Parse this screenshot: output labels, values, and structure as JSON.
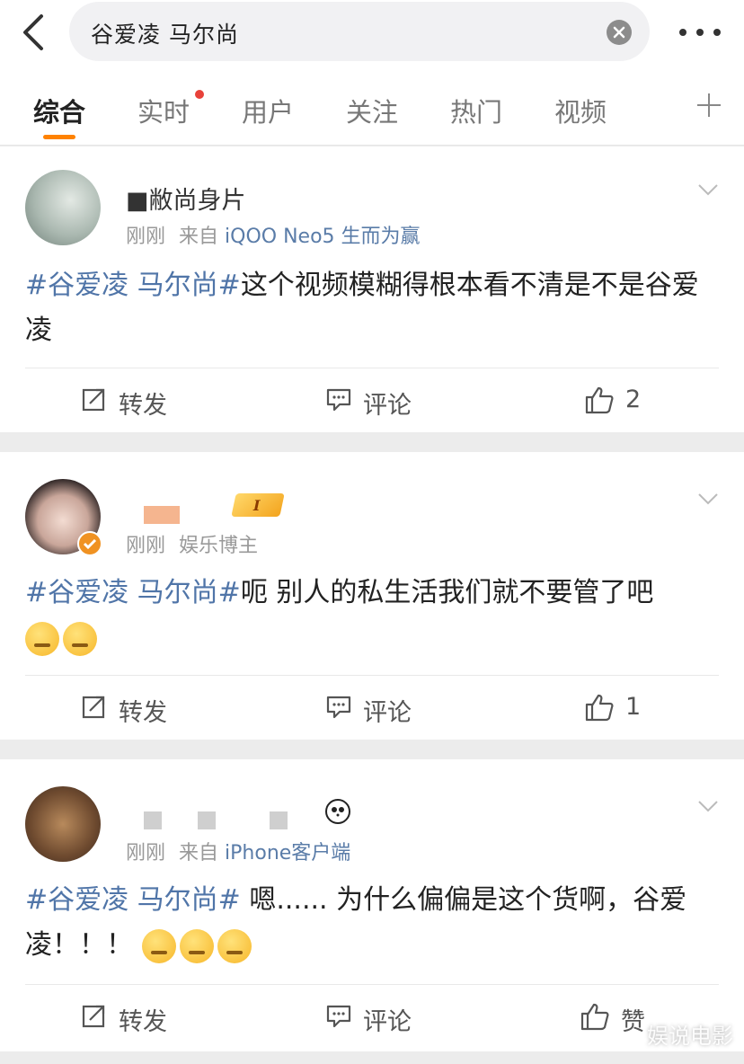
{
  "search": {
    "query": "谷爱凌 马尔尚"
  },
  "tabs": [
    {
      "label": "综合",
      "active": true
    },
    {
      "label": "实时",
      "active": false,
      "has_dot": true
    },
    {
      "label": "用户",
      "active": false
    },
    {
      "label": "关注",
      "active": false
    },
    {
      "label": "热门",
      "active": false
    },
    {
      "label": "视频",
      "active": false
    }
  ],
  "colors": {
    "accent": "#ff8200",
    "hashtag": "#5075a8",
    "source": "#5a7ca8"
  },
  "posts": [
    {
      "username": "■敝尚身片",
      "time": "刚刚",
      "from_prefix": "来自",
      "source": "iQOO Neo5 生而为赢",
      "hashtag": "#谷爱凌 马尔尚#",
      "text": "这个视频模糊得根本看不清是不是谷爱凌",
      "emoji_count": 0,
      "actions": {
        "repost": "转发",
        "comment": "评论",
        "like": "2"
      }
    },
    {
      "username": "",
      "time": "刚刚",
      "verified_label": "娱乐博主",
      "hashtag": "#谷爱凌 马尔尚#",
      "text": "呃 别人的私生活我们就不要管了吧",
      "emoji_count": 2,
      "actions": {
        "repost": "转发",
        "comment": "评论",
        "like": "1"
      }
    },
    {
      "username": "",
      "time": "刚刚",
      "from_prefix": "来自",
      "source": "iPhone客户端",
      "hashtag": "#谷爱凌 马尔尚#",
      "text": " 嗯...... 为什么偏偏是这个货啊，谷爱凌！！！",
      "emoji_count": 3,
      "actions": {
        "repost": "转发",
        "comment": "评论",
        "like": "赞"
      }
    }
  ],
  "watermark": "娱说电影"
}
